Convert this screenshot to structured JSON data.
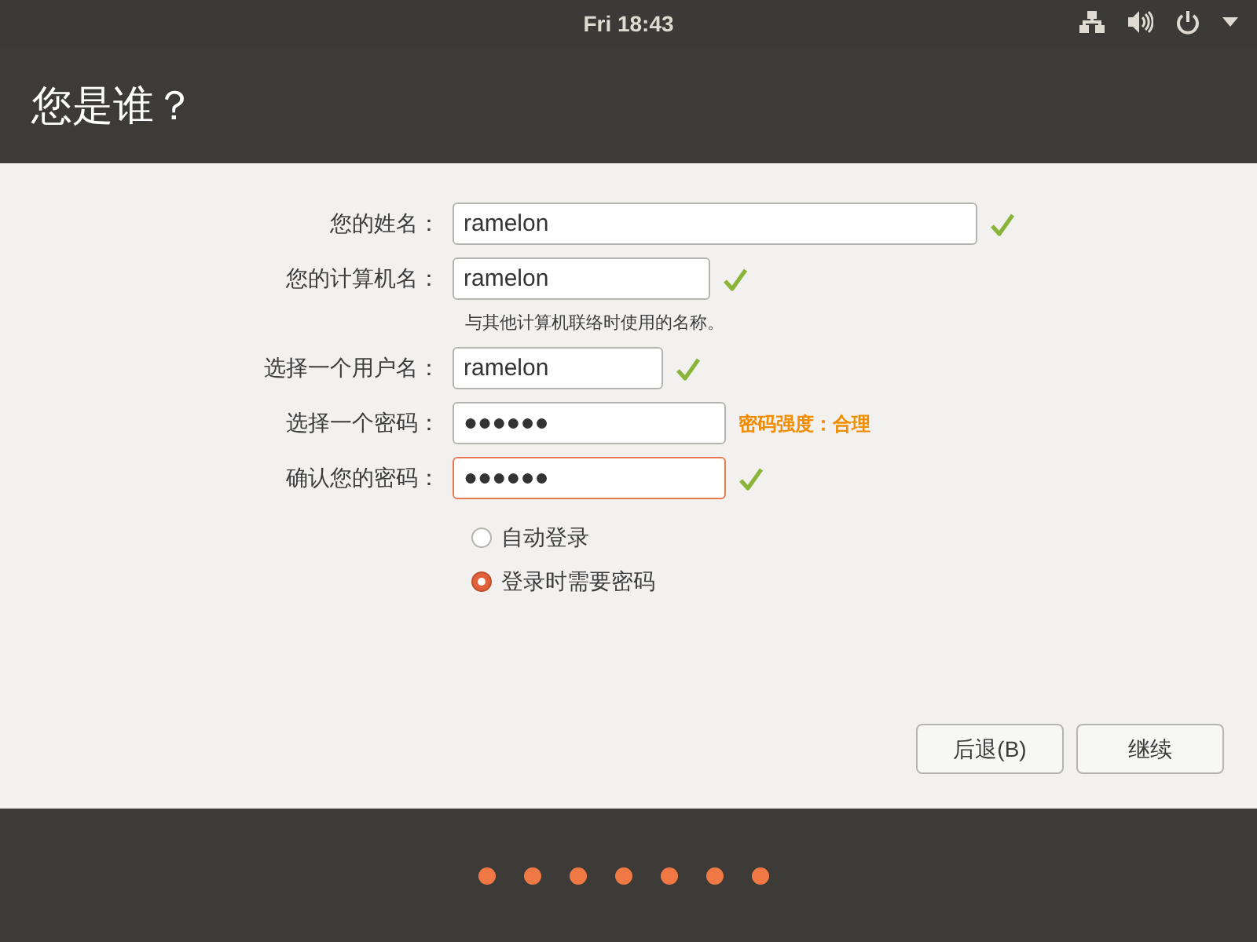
{
  "top_bar": {
    "clock": "Fri 18:43"
  },
  "header": {
    "title": "您是谁？"
  },
  "form": {
    "fields": [
      {
        "label": "您的姓名：",
        "value": "ramelon",
        "valid": true,
        "focused": false
      },
      {
        "label": "您的计算机名：",
        "value": "ramelon",
        "valid": true,
        "focused": false,
        "hint": "与其他计算机联络时使用的名称。"
      },
      {
        "label": "选择一个用户名：",
        "value": "ramelon",
        "valid": true,
        "focused": false
      },
      {
        "label": "选择一个密码：",
        "value": "●●●●●●",
        "valid": false,
        "focused": false,
        "strength": "密码强度：合理"
      },
      {
        "label": "确认您的密码：",
        "value": "●●●●●●",
        "valid": true,
        "focused": true
      }
    ],
    "login_options": [
      {
        "label": "自动登录",
        "selected": false
      },
      {
        "label": "登录时需要密码",
        "selected": true
      }
    ]
  },
  "buttons": [
    {
      "label": "后退(B)"
    },
    {
      "label": "继续"
    }
  ]
}
